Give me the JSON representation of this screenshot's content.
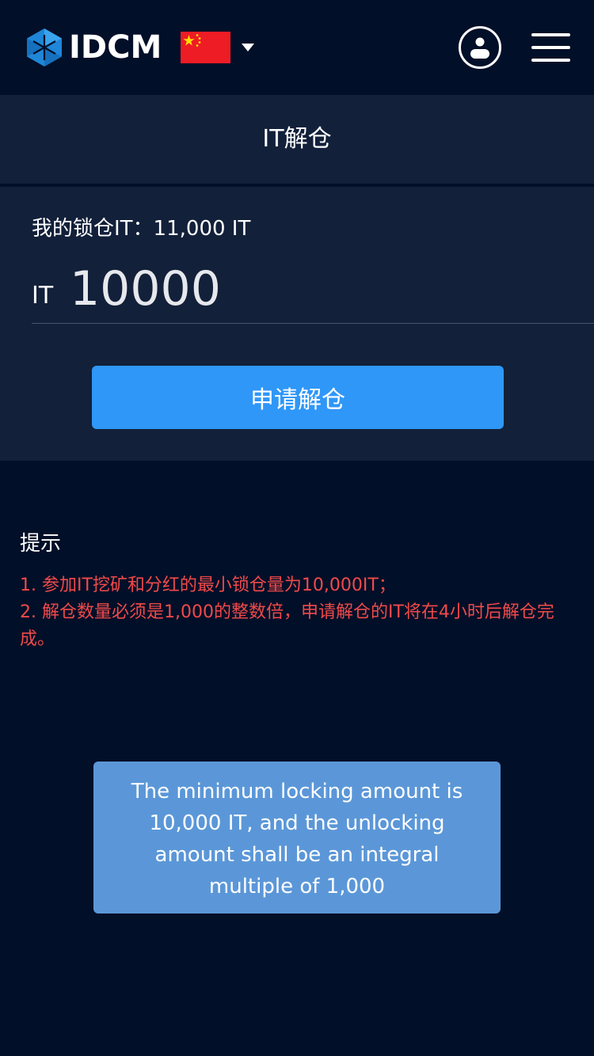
{
  "navbar": {
    "brand": "IDCM",
    "language": "CN",
    "icons": {
      "logo": "idcm-hexagon-logo",
      "language_flag": "china-flag-icon",
      "dropdown": "caret-down-icon",
      "account": "user-circle-icon",
      "menu": "hamburger-menu-icon"
    },
    "colors": {
      "logo_blue": "#1f86d8",
      "flag_red": "#ee1c25",
      "flag_star": "#ffde00"
    }
  },
  "page": {
    "title": "IT解仓"
  },
  "form": {
    "locked_label": "我的锁仓IT：11,000 IT",
    "amount_prefix": "IT",
    "amount_value": "10000",
    "submit_label": "申请解仓"
  },
  "tips": {
    "title": "提示",
    "items": [
      "1. 参加IT挖矿和分红的最小锁仓量为10,000IT；",
      "2. 解仓数量必须是1,000的整数倍，申请解仓的IT将在4小时后解仓完成。"
    ]
  },
  "toast": {
    "message": "The minimum locking amount  is 10,000 IT, and the unlocking amount shall be an integral multiple of 1,000"
  },
  "theme": {
    "background": "#020f28",
    "panel": "#12203a",
    "primary_button": "#2f97f8",
    "tip_text": "#f04a4a",
    "toast_background": "#5b97d8"
  }
}
